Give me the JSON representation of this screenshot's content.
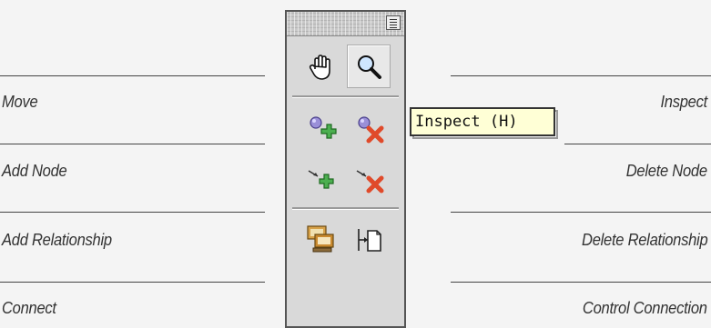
{
  "labels_left": [
    "Move",
    "Add Node",
    "Add Relationship",
    "Connect"
  ],
  "labels_right": [
    "Inspect",
    "Delete Node",
    "Delete Relationship",
    "Control Connection"
  ],
  "tooltip": {
    "text": "Inspect (H)"
  },
  "tools": [
    {
      "name": "move",
      "icon": "hand-icon"
    },
    {
      "name": "inspect",
      "icon": "magnifier-icon",
      "active": true
    },
    {
      "name": "add-node",
      "icon": "add-node-icon"
    },
    {
      "name": "delete-node",
      "icon": "delete-node-icon"
    },
    {
      "name": "add-relationship",
      "icon": "add-relationship-icon"
    },
    {
      "name": "delete-relationship",
      "icon": "delete-relationship-icon"
    },
    {
      "name": "connect",
      "icon": "connect-icon"
    },
    {
      "name": "control-connection",
      "icon": "control-connection-icon"
    }
  ],
  "colors": {
    "tooltip_bg": "#ffffd6",
    "add_green": "#4caf50",
    "delete_red": "#e04a2a"
  }
}
